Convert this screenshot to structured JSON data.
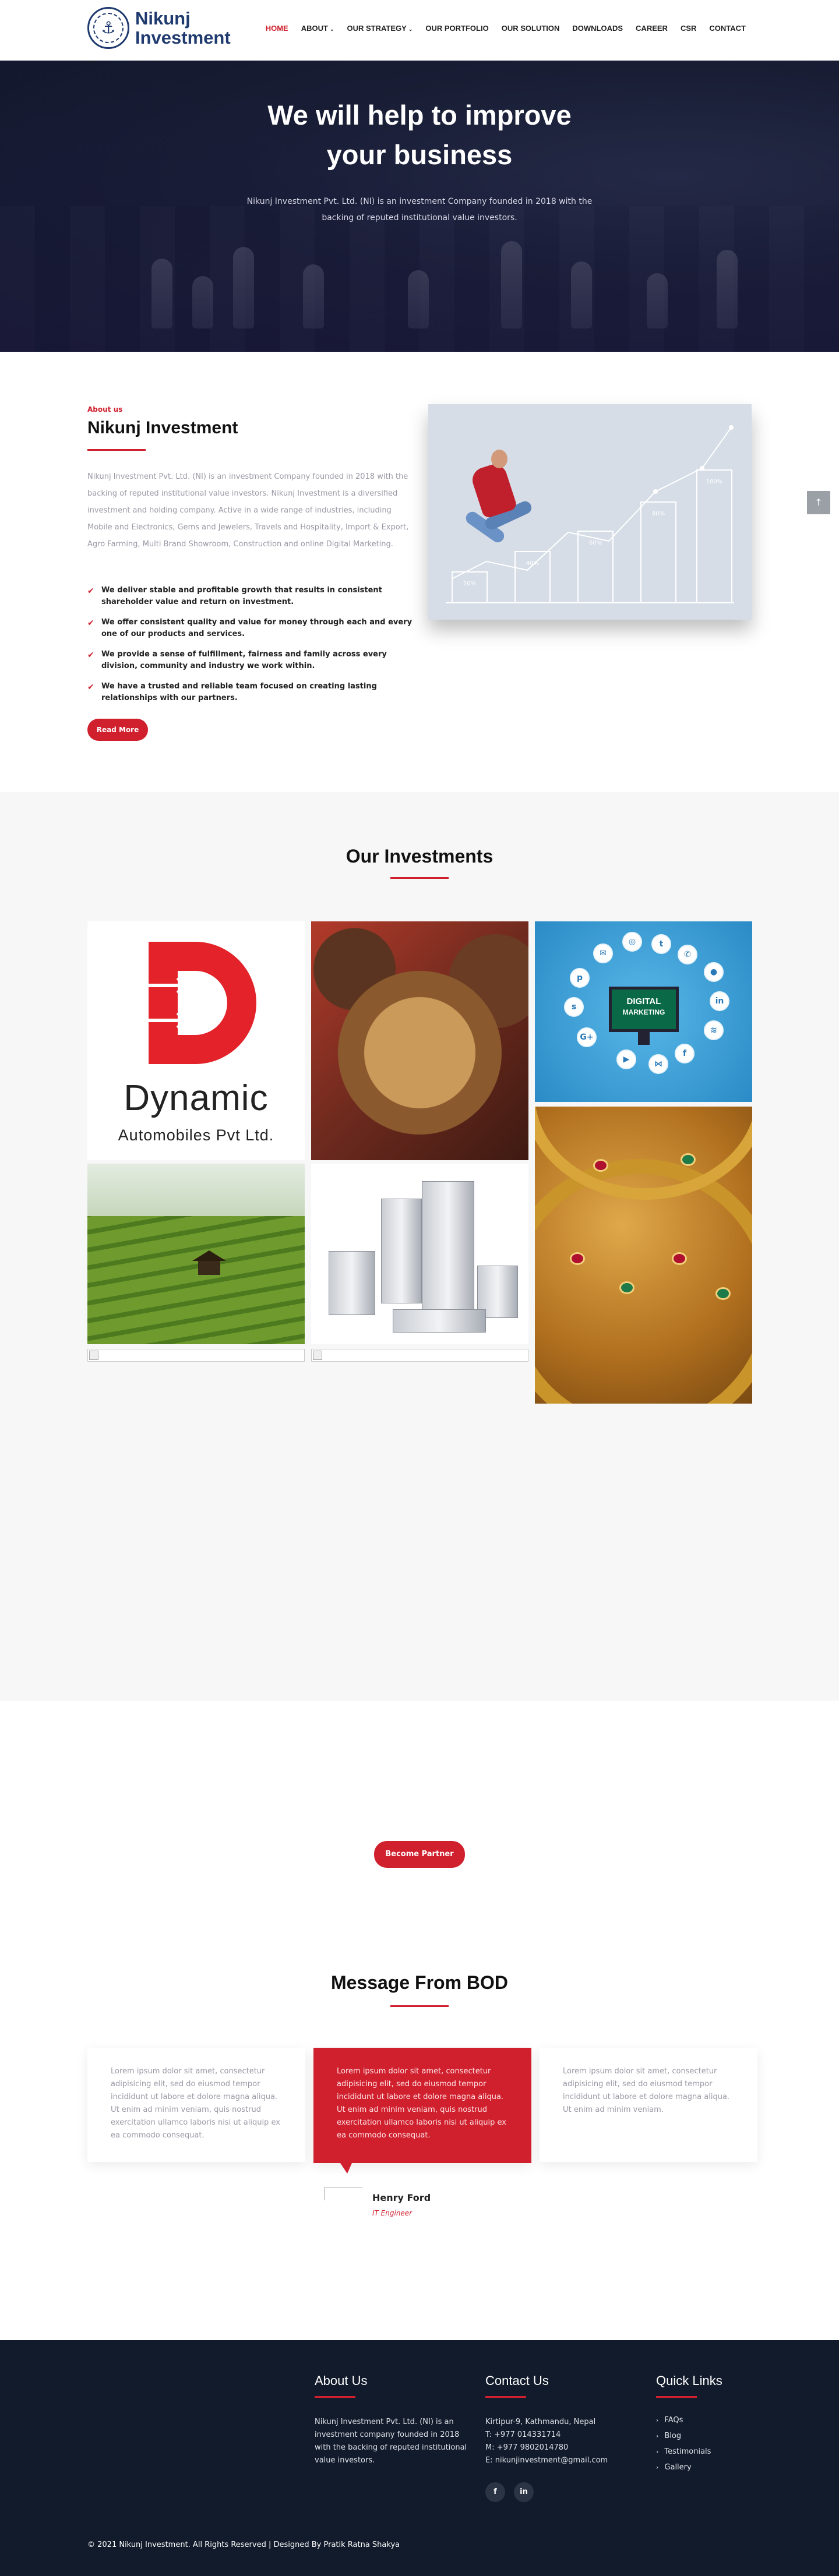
{
  "brand": {
    "line1": "Nikunj",
    "line2": "Investment"
  },
  "nav": [
    {
      "label": "HOME",
      "active": true,
      "has_caret": false
    },
    {
      "label": "ABOUT",
      "active": false,
      "has_caret": true
    },
    {
      "label": "OUR STRATEGY",
      "active": false,
      "has_caret": true
    },
    {
      "label": "OUR PORTFOLIO",
      "active": false,
      "has_caret": false
    },
    {
      "label": "OUR SOLUTION",
      "active": false,
      "has_caret": false
    },
    {
      "label": "DOWNLOADS",
      "active": false,
      "has_caret": false
    },
    {
      "label": "CAREER",
      "active": false,
      "has_caret": false
    },
    {
      "label": "CSR",
      "active": false,
      "has_caret": false
    },
    {
      "label": "CONTACT",
      "active": false,
      "has_caret": false
    }
  ],
  "hero": {
    "title_line1": "We will help to improve",
    "title_line2": "your business",
    "subtitle": "Nikunj Investment Pvt. Ltd. (NI) is an investment Company founded in 2018 with the backing of reputed institutional value investors."
  },
  "about": {
    "eyebrow": "About us",
    "title": "Nikunj Investment",
    "body": "Nikunj Investment Pvt. Ltd. (NI) is an investment Company founded in 2018 with the backing of reputed institutional value investors. Nikunj Investment is a diversified investment and holding company. Active in a wide range of industries, including Mobile and Electronics, Gems and Jewelers, Travels and Hospitality, Import & Export, Agro Farming, Multi Brand Showroom, Construction and online Digital Marketing.",
    "points": [
      "We deliver stable and profitable growth that results in consistent shareholder value and return on investment.",
      "We offer consistent quality and value for money through each and every one of our products and services.",
      "We provide a sense of fulfillment, fairness and family across every division, community and industry we work within.",
      "We have a trusted and reliable team focused on creating lasting relationships with our partners."
    ],
    "read_more": "Read More",
    "illustration_bars": [
      "20%",
      "40%",
      "60%",
      "80%",
      "100%"
    ]
  },
  "side_button": "↑",
  "investments": {
    "title": "Our Investments",
    "dynamic_name": "Dynamic",
    "dynamic_sub": "Automobiles Pvt Ltd.",
    "digital_line1": "DIGITAL",
    "digital_line2": "MARKETING"
  },
  "partner": {
    "label": "Become Partner"
  },
  "bod": {
    "title": "Message From BOD",
    "cards": [
      "Lorem ipsum dolor sit amet, consectetur adipisicing elit, sed do eiusmod tempor incididunt ut labore et dolore magna aliqua. Ut enim ad minim veniam, quis nostrud exercitation ullamco laboris nisi ut aliquip ex ea commodo consequat.",
      "Lorem ipsum dolor sit amet, consectetur adipisicing elit, sed do eiusmod tempor incididunt ut labore et dolore magna aliqua. Ut enim ad minim veniam, quis nostrud exercitation ullamco laboris nisi ut aliquip ex ea commodo consequat.",
      "Lorem ipsum dolor sit amet, consectetur adipisicing elit, sed do eiusmod tempor incididunt ut labore et dolore magna aliqua. Ut enim ad minim veniam."
    ],
    "person_name": "Henry Ford",
    "person_role": "IT Engineer"
  },
  "footer": {
    "about_title": "About Us",
    "about_text": "Nikunj Investment Pvt. Ltd. (NI) is an investment company founded in 2018 with the backing of reputed institutional value investors.",
    "contact_title": "Contact Us",
    "contact_lines": [
      "Kirtipur-9, Kathmandu, Nepal",
      "T: +977 014331714",
      "M: +977 9802014780",
      "E: nikunjinvestment@gmail.com"
    ],
    "social": [
      "f",
      "in"
    ],
    "links_title": "Quick Links",
    "links": [
      "FAQs",
      "Blog",
      "Testimonials",
      "Gallery"
    ],
    "copyright": "© 2021 Nikunj Investment. All Rights Reserved | Designed By Pratik Ratna Shakya"
  },
  "colors": {
    "accent": "#d0202e",
    "brand": "#1f3a6e",
    "footer_bg": "#121b2b",
    "section_bg": "#f7f7f7"
  }
}
